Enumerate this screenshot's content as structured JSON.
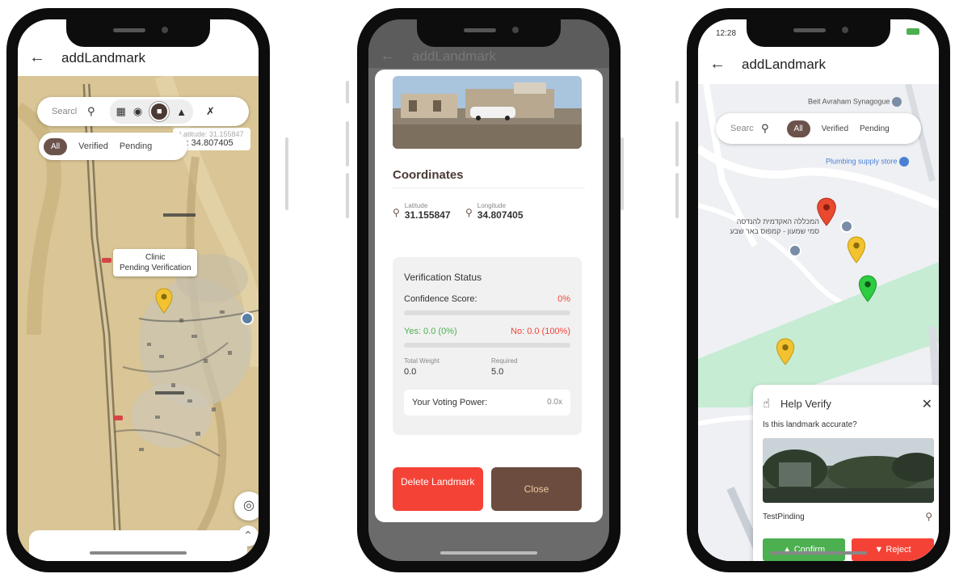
{
  "screens": [
    {
      "app_bar": {
        "back_icon": "arrow-left-icon",
        "title": "addLandmark"
      },
      "search": {
        "placeholder": "Searcl"
      },
      "filters": [
        "All",
        "Verified",
        "Pending"
      ],
      "coord_overlay": {
        "hidden_text": "Latitude: 31.155847",
        "text": "le: 34.807405"
      },
      "tooltip": {
        "title": "Clinic",
        "subtitle": "Pending Verification"
      }
    },
    {
      "app_bar": {
        "back_icon": "arrow-left-icon",
        "title": "addLandmark"
      },
      "coordinates": {
        "title": "Coordinates",
        "latitude_label": "Latitude",
        "latitude": "31.155847",
        "longitude_label": "Longitude",
        "longitude": "34.807405"
      },
      "verification": {
        "title": "Verification Status",
        "confidence_label": "Confidence Score:",
        "confidence_value": "0%",
        "yes": "Yes: 0.0 (0%)",
        "no": "No: 0.0 (100%)",
        "total_weight_label": "Total Weight",
        "total_weight": "0.0",
        "required_label": "Required",
        "required": "5.0",
        "voting_power_label": "Your Voting Power:",
        "voting_power": "0.0x"
      },
      "buttons": {
        "delete": "Delete Landmark",
        "close": "Close"
      }
    },
    {
      "status_bar": {
        "time": "12:28"
      },
      "app_bar": {
        "back_icon": "arrow-left-icon",
        "title": "addLandmark"
      },
      "search": {
        "placeholder": "Searc"
      },
      "filters": [
        "All",
        "Verified",
        "Pending"
      ],
      "pois": {
        "synagogue": "Beit Avraham Synagogue",
        "plumbing": "Plumbing supply store",
        "college_line1": "המכללה האקדמית להנדסה",
        "college_line2": "סמי שמעון - קמפוס באר שבע"
      },
      "help_card": {
        "title": "Help Verify",
        "question": "Is this landmark accurate?",
        "landmark_name": "TestPinding",
        "confirm": "Confirm",
        "reject": "Reject"
      }
    }
  ],
  "colors": {
    "accent_brown": "#6b534b",
    "delete_red": "#f44336",
    "close_brown": "#6b4c3e",
    "confirm_green": "#4caf50",
    "pin_yellow": "#f2c230",
    "pin_red": "#e8492f",
    "pin_green": "#2ecc40"
  }
}
